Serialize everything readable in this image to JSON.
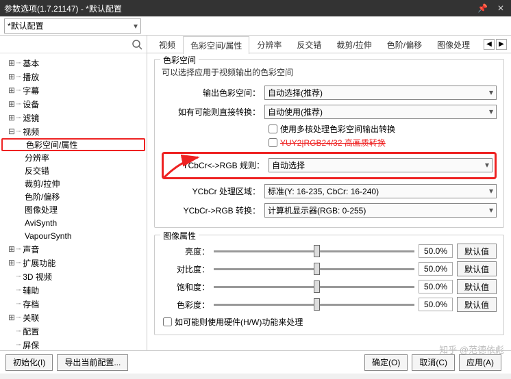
{
  "window": {
    "title": "参数选项(1.7.21147) - *默认配置",
    "preset": "*默认配置"
  },
  "tree": {
    "basic": "基本",
    "playback": "播放",
    "subtitle": "字幕",
    "device": "设备",
    "lens": "滤镜",
    "video": "视频",
    "video_children": {
      "colorspace": "色彩空间/属性",
      "resolution": "分辨率",
      "deinterlace": "反交错",
      "crop": "裁剪/拉伸",
      "colorlevel": "色阶/偏移",
      "imageproc": "图像处理",
      "avisynth": "AviSynth",
      "vapoursynth": "VapourSynth"
    },
    "audio": "声音",
    "extend": "扩展功能",
    "threed": "3D 视频",
    "assist": "辅助",
    "archive": "存档",
    "assoc": "关联",
    "config": "配置",
    "screensaver": "屏保"
  },
  "tabs": {
    "video": "视频",
    "colorspace": "色彩空间/属性",
    "resolution": "分辨率",
    "deinterlace": "反交错",
    "crop": "裁剪/拉伸",
    "colorlevel": "色阶/偏移",
    "imageproc": "图像处理"
  },
  "colorspace": {
    "group_title": "色彩空间",
    "desc": "可以选择应用于视频输出的色彩空间",
    "output_label": "输出色彩空间：",
    "output_value": "自动选择(推荐)",
    "direct_label": "如有可能则直接转换：",
    "direct_value": "自动使用(推荐)",
    "chk_multicore": "使用多核处理色彩空间输出转换",
    "chk_hq": "YUY2|RGB24/32 高画质转换",
    "rule_label": "YCbCr<->RGB 规则：",
    "rule_value": "自动选择",
    "range_label": "YCbCr 处理区域：",
    "range_value": "标准(Y: 16-235, CbCr: 16-240)",
    "convert_label": "YCbCr->RGB 转换：",
    "convert_value": "计算机显示器(RGB: 0-255)"
  },
  "imageattr": {
    "group_title": "图像属性",
    "brightness": "亮度：",
    "contrast": "对比度：",
    "saturation": "饱和度：",
    "hue": "色彩度：",
    "val": "50.0%",
    "default_btn": "默认值",
    "hw_chk": "如可能则使用硬件(H/W)功能来处理"
  },
  "footer": {
    "init": "初始化(I)",
    "export": "导出当前配置...",
    "ok": "确定(O)",
    "cancel": "取消(C)",
    "apply": "应用(A)"
  },
  "watermark": "知乎 @范德依彪"
}
